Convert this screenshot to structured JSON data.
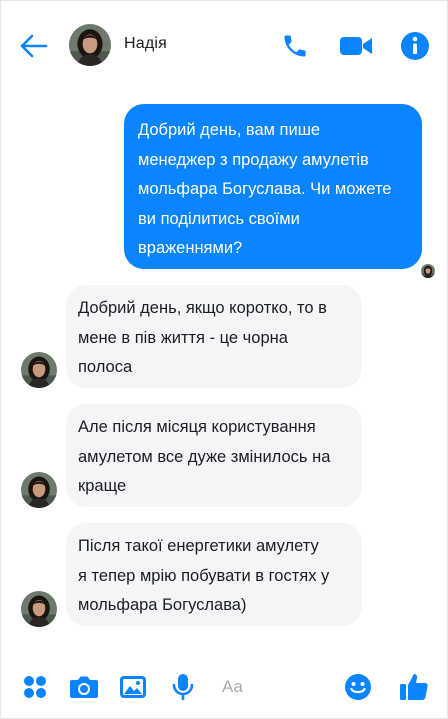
{
  "header": {
    "contact_name": "Надія",
    "icons": [
      "back-arrow-icon",
      "phone-icon",
      "video-camera-icon",
      "info-icon"
    ]
  },
  "colors": {
    "accent": "#0a84ff",
    "incoming_bubble": "#f3f5f7",
    "text": "#1c1e21",
    "placeholder": "#a8abaf"
  },
  "messages": {
    "outgoing": [
      {
        "lines": [
          "Добрий день, вам пише",
          "менеджер з продажу амулетів",
          "мольфара Богуслава. Чи можете",
          "ви поділитись своїми",
          "враженнями?"
        ]
      }
    ],
    "incoming": [
      {
        "lines": [
          "Добрий день, якщо коротко, то в",
          "мене в пів життя - це чорна",
          "полоса"
        ]
      },
      {
        "lines": [
          "Але після місяця користування",
          "амулетом все дуже змінилось на",
          "краще"
        ]
      },
      {
        "lines": [
          "Після такої енергетики амулету",
          "я тепер мрію побувати в гостях у",
          "мольфара Богуслава)"
        ]
      }
    ]
  },
  "composer": {
    "placeholder": "Aa",
    "icons": [
      "apps-icon",
      "camera-icon",
      "gallery-icon",
      "microphone-icon",
      "emoji-icon",
      "thumbs-up-icon"
    ]
  }
}
